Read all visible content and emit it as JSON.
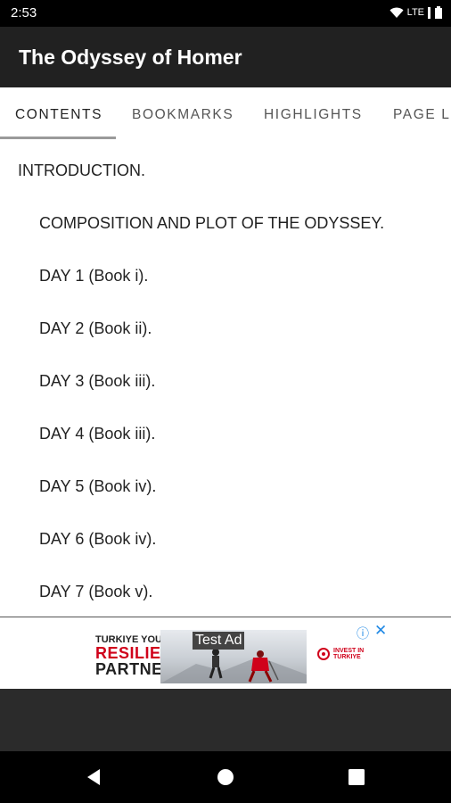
{
  "status_bar": {
    "time": "2:53",
    "network": "LTE",
    "icons": [
      "wifi-icon",
      "signal-icon",
      "battery-icon"
    ]
  },
  "app_bar": {
    "title": "The Odyssey of Homer"
  },
  "tabs": [
    {
      "label": "CONTENTS",
      "active": true
    },
    {
      "label": "BOOKMARKS",
      "active": false
    },
    {
      "label": "HIGHLIGHTS",
      "active": false
    },
    {
      "label": "PAGE L",
      "active": false
    }
  ],
  "contents": [
    "INTRODUCTION.",
    "COMPOSITION AND PLOT OF THE ODYSSEY.",
    "DAY 1 (Book i).",
    "DAY 2 (Book ii).",
    "DAY 3 (Book iii).",
    "DAY 4 (Book iii).",
    "DAY 5 (Book iv).",
    "DAY 6 (Book iv).",
    "DAY 7 (Book v)."
  ],
  "ad": {
    "label": "Test Ad",
    "headline_1": "TURKIYE YOUR",
    "headline_2": "RESILIENT",
    "headline_3": "PARTNER",
    "sponsor": "INVEST IN TURKIYE",
    "info_icon": "info-icon",
    "close_icon": "close-icon",
    "accent_color": "#d0021b"
  },
  "nav_bar": {
    "icons": [
      "back-icon",
      "home-icon",
      "recents-icon"
    ]
  }
}
